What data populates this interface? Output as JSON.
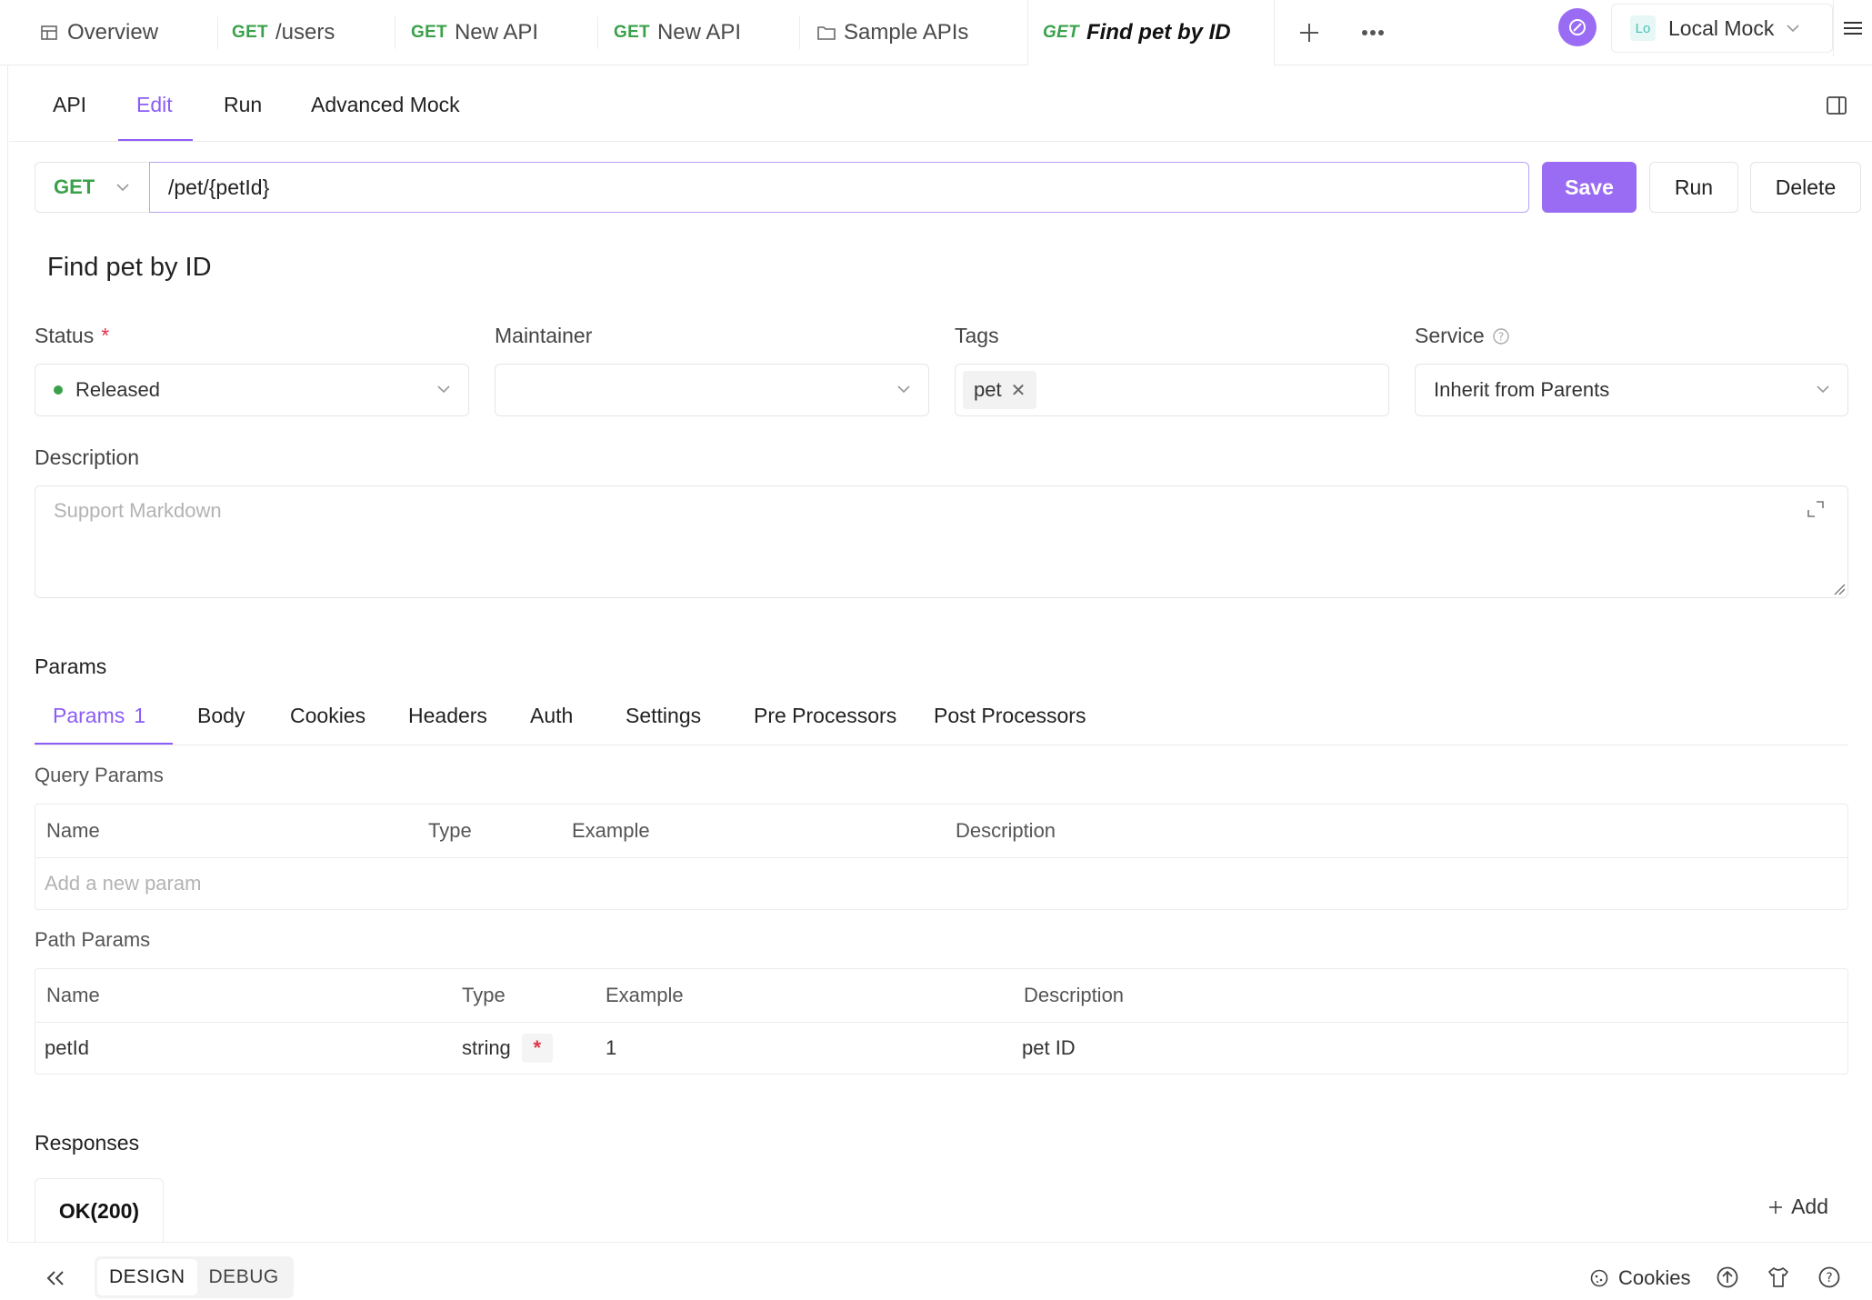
{
  "top_tabs": [
    {
      "method": "",
      "label": "Overview",
      "icon": "table-icon"
    },
    {
      "method": "GET",
      "label": "/users"
    },
    {
      "method": "GET",
      "label": "New API"
    },
    {
      "method": "GET",
      "label": "New API"
    },
    {
      "method": "",
      "label": "Sample APIs",
      "icon": "folder-icon"
    },
    {
      "method": "GET",
      "label": "Find pet by ID",
      "active": true
    }
  ],
  "environment": {
    "abbr": "Lo",
    "label": "Local Mock"
  },
  "sub_tabs": [
    "API",
    "Edit",
    "Run",
    "Advanced Mock"
  ],
  "active_sub_tab": "Edit",
  "request": {
    "method": "GET",
    "path": "/pet/{petId}",
    "save_label": "Save",
    "run_label": "Run",
    "delete_label": "Delete"
  },
  "endpoint_title": "Find pet by ID",
  "fields": {
    "status_label": "Status",
    "status_required": "*",
    "status_value": "Released",
    "maintainer_label": "Maintainer",
    "maintainer_value": "",
    "tags_label": "Tags",
    "tags": [
      "pet"
    ],
    "service_label": "Service",
    "service_value": "Inherit from Parents",
    "description_label": "Description",
    "description_placeholder": "Support Markdown"
  },
  "params_section": {
    "title": "Params",
    "tabs": [
      {
        "label": "Params",
        "count": "1"
      },
      {
        "label": "Body"
      },
      {
        "label": "Cookies"
      },
      {
        "label": "Headers"
      },
      {
        "label": "Auth"
      },
      {
        "label": "Settings"
      },
      {
        "label": "Pre Processors"
      },
      {
        "label": "Post Processors"
      }
    ]
  },
  "query_params": {
    "title": "Query Params",
    "columns": [
      "Name",
      "Type",
      "Example",
      "Description"
    ],
    "add_placeholder": "Add a new param"
  },
  "path_params": {
    "title": "Path Params",
    "columns": [
      "Name",
      "Type",
      "Example",
      "Description"
    ],
    "rows": [
      {
        "name": "petId",
        "type": "string",
        "required": "*",
        "example": "1",
        "description": "pet ID"
      }
    ]
  },
  "responses": {
    "title": "Responses",
    "tabs": [
      "OK(200)"
    ],
    "add_label": "Add"
  },
  "bottom_bar": {
    "modes": [
      "DESIGN",
      "DEBUG"
    ],
    "active_mode": "DESIGN",
    "cookies_label": "Cookies"
  },
  "colors": {
    "accent": "#8c5cf6",
    "primary_button": "#9a6cf3",
    "get_method": "#3aa14a",
    "required": "#e0344b"
  }
}
